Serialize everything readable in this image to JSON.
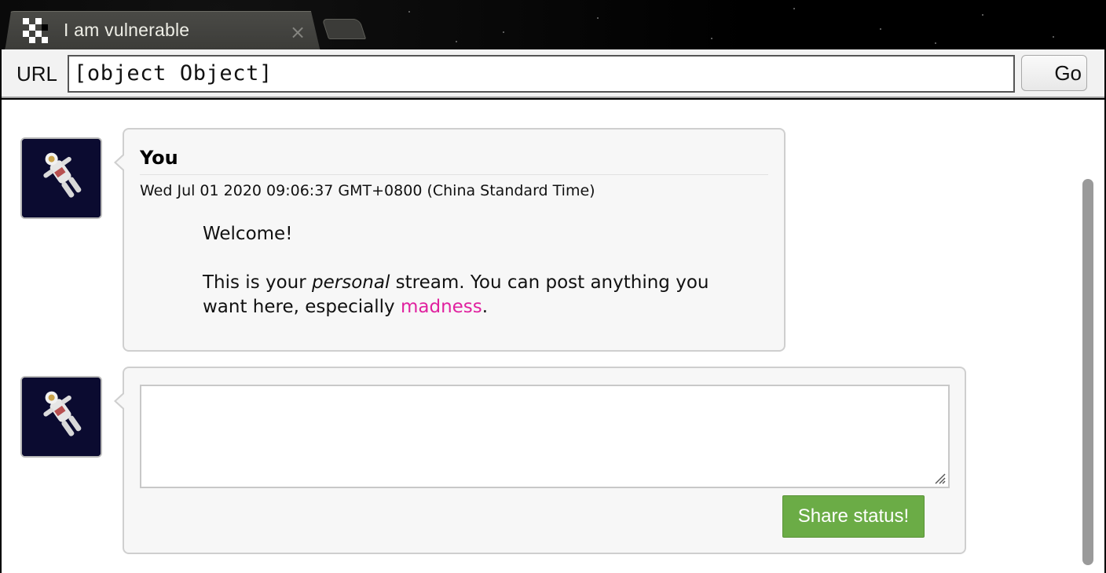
{
  "browser": {
    "tab": {
      "title": "I am vulnerable",
      "close_glyph": "×",
      "favicon": "checker-icon"
    },
    "new_tab_icon": "new-tab-icon",
    "url_bar": {
      "label": "URL",
      "value": "[object Object]",
      "go_label": "Go"
    }
  },
  "stream": {
    "post": {
      "author": "You",
      "date": "Wed Jul 01 2020 09:06:37 GMT+0800 (China Standard Time)",
      "line1": "Welcome!",
      "line2_before": "This is your ",
      "line2_em": "personal",
      "line2_after": " stream. You can post anything you want here, especially ",
      "link_text": "madness",
      "line2_end": ".",
      "avatar": "astronaut-avatar"
    },
    "composer": {
      "text": "",
      "button_label": "Share status!",
      "avatar": "astronaut-avatar"
    }
  },
  "colors": {
    "link": "#e0219f",
    "share_button": "#6bac46",
    "bubble_bg": "#f7f7f7"
  }
}
